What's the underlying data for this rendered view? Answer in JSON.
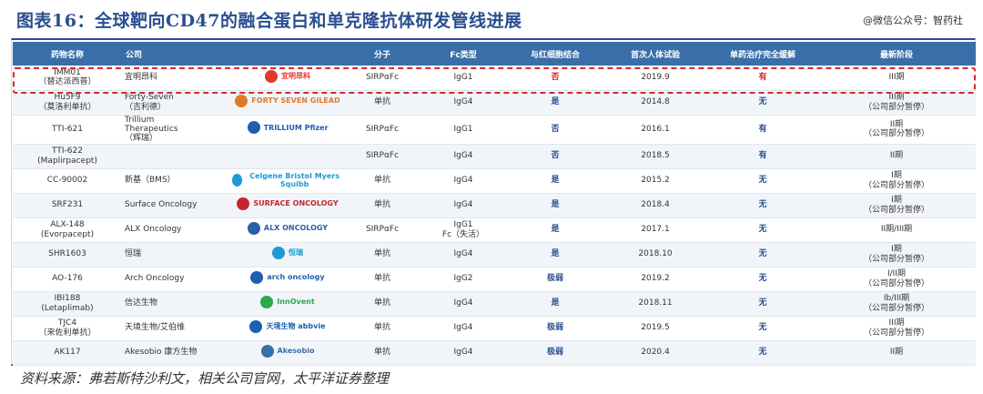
{
  "title": "图表16：全球靶向CD47的融合蛋白和单克隆抗体研发管线进展",
  "watermark": "@微信公众号：智药社",
  "source": "资料来源：弗若斯特沙利文，相关公司官网，太平洋证券整理",
  "colors": {
    "header_bg": "#3a6ea8",
    "title": "#2a4f8f",
    "highlight": "#d9282a"
  },
  "columns": [
    "药物名称",
    "公司",
    "",
    "分子",
    "Fc类型",
    "与红细胞结合",
    "首次人体试验",
    "单药治疗完全缓解",
    "最新阶段"
  ],
  "rows": [
    {
      "drug": "IMM01\n（替达派西普）",
      "company": "宜明昂科",
      "logo": "宜明昂科",
      "molecule": "SIRPαFc",
      "fc": "IgG1",
      "rbc": "否",
      "rbc_red": true,
      "trial": "2019.9",
      "cr": "有",
      "cr_red": true,
      "stage": "III期"
    },
    {
      "drug": "Hu5F9\n（莫洛利单抗）",
      "company": "Forty-Seven\n（吉利德）",
      "logo": "FORTY SEVEN  GILEAD",
      "molecule": "单抗",
      "fc": "IgG4",
      "rbc": "是",
      "trial": "2014.8",
      "cr": "无",
      "stage": "III期\n（公司部分暂停）"
    },
    {
      "drug": "TTI-621",
      "company": "Trillium\nTherapeutics\n（辉瑞）",
      "logo": "TRILLIUM  Pfizer",
      "molecule": "SIRPαFc",
      "fc": "IgG1",
      "rbc": "否",
      "trial": "2016.1",
      "cr": "有",
      "stage": "II期\n（公司部分暂停）"
    },
    {
      "drug": "TTI-622\n(Maplirpacept)",
      "company": "",
      "logo": "",
      "molecule": "SIRPαFc",
      "fc": "IgG4",
      "rbc": "否",
      "trial": "2018.5",
      "cr": "有",
      "stage": "II期"
    },
    {
      "drug": "CC-90002",
      "company": "新基（BMS）",
      "logo": "Celgene  Bristol Myers Squibb",
      "molecule": "单抗",
      "fc": "IgG4",
      "rbc": "是",
      "trial": "2015.2",
      "cr": "无",
      "stage": "I期\n（公司部分暂停）"
    },
    {
      "drug": "SRF231",
      "company": "Surface Oncology",
      "logo": "SURFACE ONCOLOGY",
      "molecule": "单抗",
      "fc": "IgG4",
      "rbc": "是",
      "trial": "2018.4",
      "cr": "无",
      "stage": "I期\n（公司部分暂停）"
    },
    {
      "drug": "ALX-148\n(Evorpacept)",
      "company": "ALX Oncology",
      "logo": "ALX ONCOLOGY",
      "molecule": "SIRPαFc",
      "fc": "IgG1\nFc（失活）",
      "rbc": "是",
      "trial": "2017.1",
      "cr": "无",
      "stage": "II期/III期"
    },
    {
      "drug": "SHR1603",
      "company": "恒瑞",
      "logo": "恒瑞",
      "molecule": "单抗",
      "fc": "IgG4",
      "rbc": "是",
      "trial": "2018.10",
      "cr": "无",
      "stage": "I期\n（公司部分暂停）"
    },
    {
      "drug": "AO-176",
      "company": "Arch Oncology",
      "logo": "arch oncology",
      "molecule": "单抗",
      "fc": "IgG2",
      "rbc": "极弱",
      "trial": "2019.2",
      "cr": "无",
      "stage": "I/II期\n（公司部分暂停）"
    },
    {
      "drug": "IBI188\n(Letaplimab)",
      "company": "信达生物",
      "logo": "InnOvent",
      "molecule": "单抗",
      "fc": "IgG4",
      "rbc": "是",
      "trial": "2018.11",
      "cr": "无",
      "stage": "Ib/III期\n（公司部分暂停）"
    },
    {
      "drug": "TJC4\n（来佐利单抗）",
      "company": "天境生物/艾伯维",
      "logo": "天境生物  abbvie",
      "molecule": "单抗",
      "fc": "IgG4",
      "rbc": "极弱",
      "trial": "2019.5",
      "cr": "无",
      "stage": "III期\n（公司部分暂停）"
    },
    {
      "drug": "AK117",
      "company": "Akesobio 康方生物",
      "logo": "Akesobio",
      "molecule": "单抗",
      "fc": "IgG4",
      "rbc": "极弱",
      "trial": "2020.4",
      "cr": "无",
      "stage": "II期"
    }
  ]
}
